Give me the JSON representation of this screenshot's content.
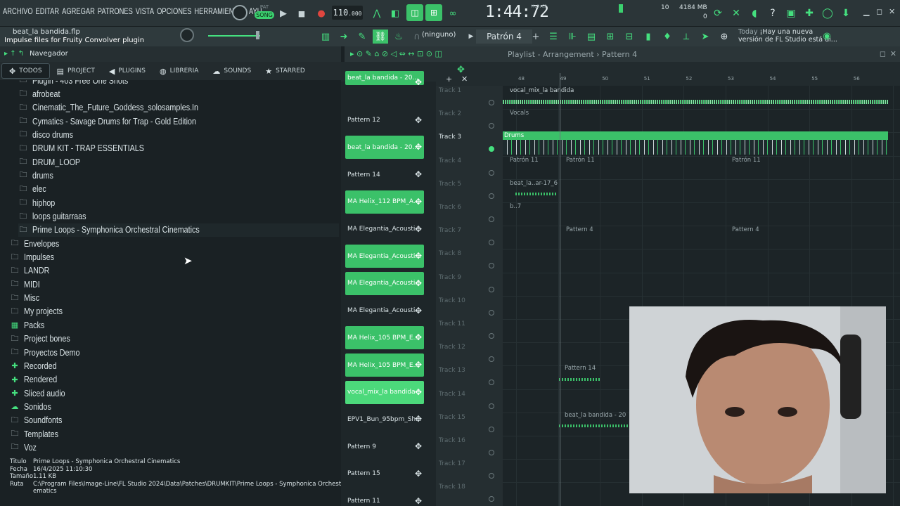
{
  "menu": [
    "ARCHIVO",
    "EDITAR",
    "AGREGAR",
    "PATRONES",
    "VISTA",
    "OPCIONES",
    "HERRAMIENTAS",
    "AYU"
  ],
  "transport": {
    "pat_label": "PAT",
    "song_label": "SONG",
    "play": "▶",
    "stop": "■",
    "record": "●",
    "bpm": "110",
    "bpm_decimal": ".000"
  },
  "time": {
    "value": "1:44:72",
    "unit_label": "M:S:CS"
  },
  "cpu": {
    "value": "10",
    "polyphony": "0"
  },
  "memory": {
    "value": "4184 MB",
    "sub": "0"
  },
  "file": {
    "name": "beat_la bandida.flp",
    "hint": "Impulse files for Fruity Convolver plugin"
  },
  "pattern_selector": {
    "snap": "(ninguno)",
    "pattern": "Patrón 4"
  },
  "news": {
    "today": "Today",
    "text_line1": "¡Hay una nueva",
    "text_line2": "versión de FL Studio está di..."
  },
  "navigator": {
    "label": "Navegador"
  },
  "browser_tabs": [
    {
      "label": "TODOS",
      "icon": "all-icon",
      "active": true
    },
    {
      "label": "PROJECT",
      "icon": "project-icon"
    },
    {
      "label": "PLUGINS",
      "icon": "plugins-icon"
    },
    {
      "label": "LIBRERIA",
      "icon": "library-icon"
    },
    {
      "label": "SOUNDS",
      "icon": "sounds-icon"
    },
    {
      "label": "STARRED",
      "icon": "star-icon"
    }
  ],
  "browser_items": [
    {
      "label": "Plugin - 403 Free One Shots",
      "indent": 1,
      "icon": "folder"
    },
    {
      "label": "afrobeat",
      "indent": 1,
      "icon": "folder"
    },
    {
      "label": "Cinematic_The_Future_Goddess_solosamples.In",
      "indent": 1,
      "icon": "folder"
    },
    {
      "label": "Cymatics - Savage Drums for Trap - Gold Edition",
      "indent": 1,
      "icon": "folder"
    },
    {
      "label": "disco drums",
      "indent": 1,
      "icon": "folder"
    },
    {
      "label": "DRUM KIT - TRAP ESSENTIALS",
      "indent": 1,
      "icon": "folder"
    },
    {
      "label": "DRUM_LOOP",
      "indent": 1,
      "icon": "folder"
    },
    {
      "label": "drums",
      "indent": 1,
      "icon": "folder"
    },
    {
      "label": "elec",
      "indent": 1,
      "icon": "folder"
    },
    {
      "label": "hiphop",
      "indent": 1,
      "icon": "folder"
    },
    {
      "label": "loops guitarraas",
      "indent": 1,
      "icon": "folder"
    },
    {
      "label": "Prime Loops - Symphonica Orchestral Cinematics",
      "indent": 1,
      "icon": "folder",
      "selected": true
    },
    {
      "label": "Envelopes",
      "indent": 0,
      "icon": "folder-plus"
    },
    {
      "label": "Impulses",
      "indent": 0,
      "icon": "folder-plus"
    },
    {
      "label": "LANDR",
      "indent": 0,
      "icon": "folder-plus"
    },
    {
      "label": "MIDI",
      "indent": 0,
      "icon": "folder-plus"
    },
    {
      "label": "Misc",
      "indent": 0,
      "icon": "folder-plus"
    },
    {
      "label": "My projects",
      "indent": 0,
      "icon": "folder-plus"
    },
    {
      "label": "Packs",
      "indent": 0,
      "icon": "packs"
    },
    {
      "label": "Project bones",
      "indent": 0,
      "icon": "folder-plus"
    },
    {
      "label": "Proyectos Demo",
      "indent": 0,
      "icon": "folder-plus"
    },
    {
      "label": "Recorded",
      "indent": 0,
      "icon": "plus-green"
    },
    {
      "label": "Rendered",
      "indent": 0,
      "icon": "plus-green"
    },
    {
      "label": "Sliced audio",
      "indent": 0,
      "icon": "plus-green"
    },
    {
      "label": "Sonidos",
      "indent": 0,
      "icon": "cloud"
    },
    {
      "label": "Soundfonts",
      "indent": 0,
      "icon": "folder-plus"
    },
    {
      "label": "Templates",
      "indent": 0,
      "icon": "folder-plus"
    },
    {
      "label": "Voz",
      "indent": 0,
      "icon": "folder-plus"
    }
  ],
  "info": {
    "titulo_k": "Titulo",
    "titulo": "Prime Loops - Symphonica Orchestral Cinematics",
    "fecha_k": "Fecha",
    "fecha": "16/4/2025 11:10:30",
    "tamano_k": "Tamaño",
    "tamano": "1.11 KB",
    "ruta_k": "Ruta",
    "ruta": "C:\\Program Files\\Image-Line\\FL Studio 2024\\Data\\Patches\\DRUMKIT\\Prime Loops - Symphonica Orchestral Cin-",
    "ruta2": "ematics"
  },
  "channels": [
    {
      "label": "beat_la bandida - 20...",
      "style": "g"
    },
    {
      "label": "Pattern 12",
      "style": ""
    },
    {
      "label": "beat_la bandida - 20...",
      "style": "g"
    },
    {
      "label": "Pattern 14",
      "style": ""
    },
    {
      "label": "MA Helix_112 BPM_A...",
      "style": "g"
    },
    {
      "label": "MA Elegantia_Acousti...",
      "style": ""
    },
    {
      "label": "MA Elegantia_Acousti...",
      "style": "g"
    },
    {
      "label": "MA Elegantia_Acousti...",
      "style": "g"
    },
    {
      "label": "MA Elegantia_Acousti...",
      "style": ""
    },
    {
      "label": "MA Helix_105 BPM_E...",
      "style": "g"
    },
    {
      "label": "MA Helix_105 BPM_E...",
      "style": "g"
    },
    {
      "label": "vocal_mix_la bandida",
      "style": "gb"
    },
    {
      "label": "EPV1_Bun_95bpm_Sh...",
      "style": ""
    },
    {
      "label": "Pattern 9",
      "style": ""
    },
    {
      "label": "Pattern 15",
      "style": ""
    },
    {
      "label": "Pattern 11",
      "style": ""
    }
  ],
  "playlist": {
    "title": "Playlist - Arrangement › Pattern 4",
    "ruler": [
      "48",
      "49",
      "50",
      "51",
      "52",
      "53",
      "54",
      "55",
      "56"
    ],
    "tracks": [
      "Track 1",
      "Track 2",
      "Track 3",
      "Track 4",
      "Track 5",
      "Track 6",
      "Track 7",
      "Track 8",
      "Track 9",
      "Track 10",
      "Track 11",
      "Track 12",
      "Track 13",
      "Track 14",
      "Track 15",
      "Track 16",
      "Track 17",
      "Track 18"
    ],
    "active_track": "Track 3",
    "clips": {
      "vocal": "vocal_mix_la bandida",
      "vocals": "Vocals",
      "drums": "Drums",
      "patron11a": "Patrón 11",
      "patron11b": "Patrón 11",
      "patron11c": "Patrón 11",
      "beat": "beat_la..ar-17_6",
      "b7": "b..7",
      "pattern4a": "Pattern 4",
      "pattern4b": "Pattern 4",
      "pattern14": "Pattern 14",
      "beat2": "beat_la bandida - 20"
    }
  },
  "colors": {
    "accent": "#45e07f",
    "bg": "#1a2124",
    "clip_green": "#3bc169"
  }
}
